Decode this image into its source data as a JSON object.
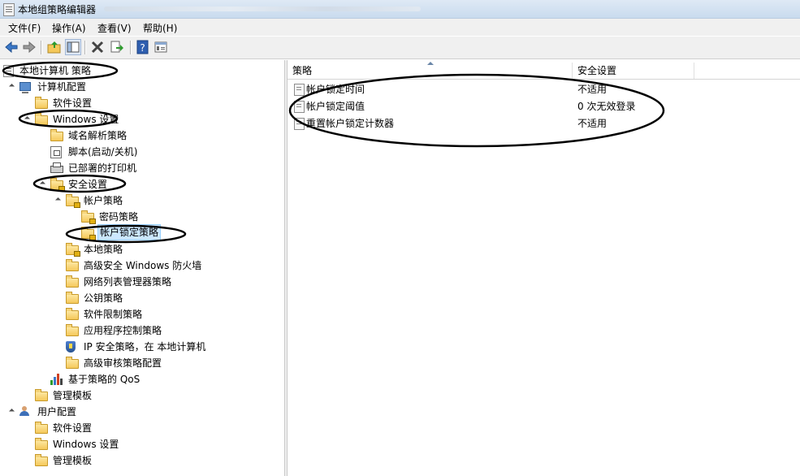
{
  "window": {
    "title": "本地组策略编辑器"
  },
  "menu": [
    "文件(F)",
    "操作(A)",
    "查看(V)",
    "帮助(H)"
  ],
  "toolbar": {
    "icons": [
      "back-arrow-icon",
      "forward-arrow-icon",
      "up-folder-icon",
      "show-hide-tree-icon",
      "delete-x-icon",
      "export-list-icon",
      "help-icon",
      "properties-icon"
    ]
  },
  "tree": [
    {
      "label": "本地计算机 策略",
      "level": 0,
      "icon": "doc",
      "twisty": "none"
    },
    {
      "label": "计算机配置",
      "level": 1,
      "icon": "computer",
      "twisty": "exp"
    },
    {
      "label": "软件设置",
      "level": 2,
      "icon": "folder",
      "twisty": "col"
    },
    {
      "label": "Windows 设置",
      "level": 2,
      "icon": "folder",
      "twisty": "exp"
    },
    {
      "label": "域名解析策略",
      "level": 3,
      "icon": "folder",
      "twisty": "col"
    },
    {
      "label": "脚本(启动/关机)",
      "level": 3,
      "icon": "script",
      "twisty": "none"
    },
    {
      "label": "已部署的打印机",
      "level": 3,
      "icon": "printer",
      "twisty": "col"
    },
    {
      "label": "安全设置",
      "level": 3,
      "icon": "lockfolder",
      "twisty": "exp"
    },
    {
      "label": "帐户策略",
      "level": 4,
      "icon": "lockfolder",
      "twisty": "exp"
    },
    {
      "label": "密码策略",
      "level": 5,
      "icon": "lockfolder",
      "twisty": "col"
    },
    {
      "label": "帐户锁定策略",
      "level": 5,
      "icon": "lockfolder",
      "twisty": "none",
      "selected": true
    },
    {
      "label": "本地策略",
      "level": 4,
      "icon": "lockfolder",
      "twisty": "col"
    },
    {
      "label": "高级安全 Windows 防火墙",
      "level": 4,
      "icon": "folder",
      "twisty": "col"
    },
    {
      "label": "网络列表管理器策略",
      "level": 4,
      "icon": "folder",
      "twisty": "none"
    },
    {
      "label": "公钥策略",
      "level": 4,
      "icon": "folder",
      "twisty": "col"
    },
    {
      "label": "软件限制策略",
      "level": 4,
      "icon": "folder",
      "twisty": "col"
    },
    {
      "label": "应用程序控制策略",
      "level": 4,
      "icon": "folder",
      "twisty": "col"
    },
    {
      "label": "IP 安全策略，在 本地计算机",
      "level": 4,
      "icon": "shield",
      "twisty": "col"
    },
    {
      "label": "高级审核策略配置",
      "level": 4,
      "icon": "folder",
      "twisty": "col"
    },
    {
      "label": "基于策略的 QoS",
      "level": 3,
      "icon": "qos",
      "twisty": "col"
    },
    {
      "label": "管理模板",
      "level": 2,
      "icon": "folder",
      "twisty": "col"
    },
    {
      "label": "用户配置",
      "level": 1,
      "icon": "users",
      "twisty": "exp"
    },
    {
      "label": "软件设置",
      "level": 2,
      "icon": "folder",
      "twisty": "col"
    },
    {
      "label": "Windows 设置",
      "level": 2,
      "icon": "folder",
      "twisty": "col"
    },
    {
      "label": "管理模板",
      "level": 2,
      "icon": "folder",
      "twisty": "col"
    }
  ],
  "list": {
    "columns": [
      "策略",
      "安全设置"
    ],
    "rows": [
      {
        "policy": "帐户锁定时间",
        "setting": "不适用"
      },
      {
        "policy": "帐户锁定阈值",
        "setting": "0 次无效登录"
      },
      {
        "policy": "重置帐户锁定计数器",
        "setting": "不适用"
      }
    ]
  },
  "annotation_color": "#000000"
}
